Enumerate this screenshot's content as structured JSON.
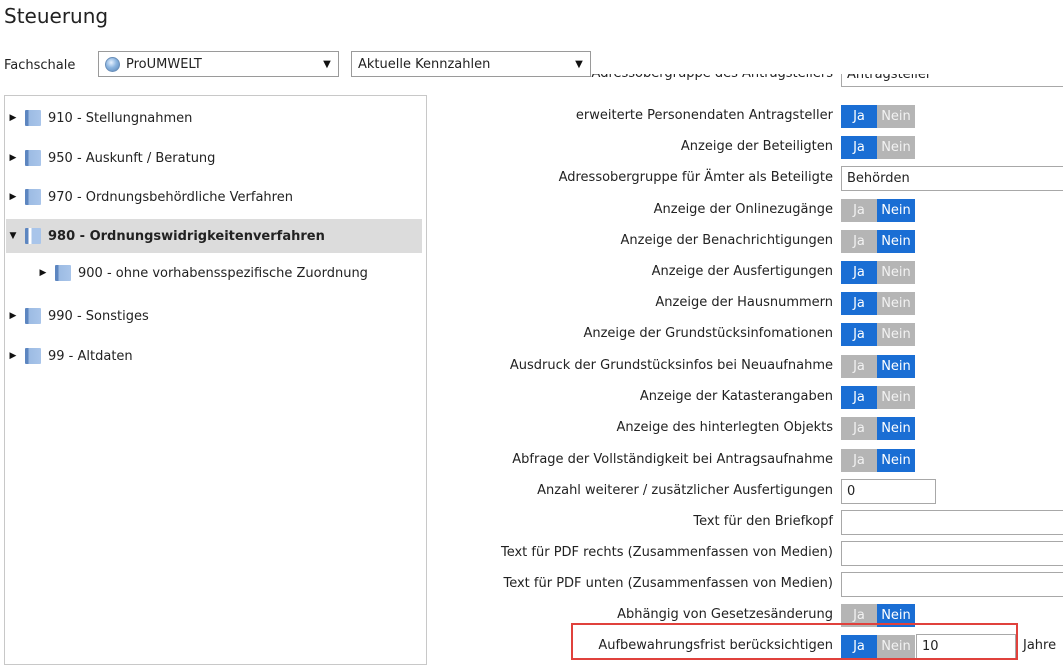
{
  "window": {
    "title": "Steuerung"
  },
  "fachschale": {
    "label": "Fachschale",
    "selected": "ProUMWELT",
    "kennzahlen_selected": "Aktuelle Kennzahlen"
  },
  "tree": {
    "nodes": [
      {
        "label": "910 - Stellungnahmen"
      },
      {
        "label": "950 - Auskunft / Beratung"
      },
      {
        "label": "970 - Ordnungsbehördliche Verfahren"
      },
      {
        "label": "980 - Ordnungswidrigkeitenverfahren"
      },
      {
        "label": "900 - ohne vorhabensspezifische Zuordnung"
      },
      {
        "label": "990 - Sonstiges"
      },
      {
        "label": "99 - Altdaten"
      }
    ]
  },
  "toggle": {
    "ja": "Ja",
    "nein": "Nein"
  },
  "form": {
    "top_partial": {
      "label": "Adressobergruppe des Antragstellers",
      "value": "Antragsteller"
    },
    "rows": [
      {
        "label": "erweiterte Personendaten Antragsteller",
        "type": "toggle",
        "value": "Ja"
      },
      {
        "label": "Anzeige der Beteiligten",
        "type": "toggle",
        "value": "Ja"
      },
      {
        "label": "Adressobergruppe für Ämter als Beteiligte",
        "type": "text",
        "value": "Behörden"
      },
      {
        "label": "Anzeige der Onlinezugänge",
        "type": "toggle",
        "value": "Nein"
      },
      {
        "label": "Anzeige der Benachrichtigungen",
        "type": "toggle",
        "value": "Nein"
      },
      {
        "label": "Anzeige der Ausfertigungen",
        "type": "toggle",
        "value": "Ja"
      },
      {
        "label": "Anzeige der Hausnummern",
        "type": "toggle",
        "value": "Ja"
      },
      {
        "label": "Anzeige der Grundstücksinfomationen",
        "type": "toggle",
        "value": "Ja"
      },
      {
        "label": "Ausdruck der Grundstücksinfos bei Neuaufnahme",
        "type": "toggle",
        "value": "Nein"
      },
      {
        "label": "Anzeige der Katasterangaben",
        "type": "toggle",
        "value": "Ja"
      },
      {
        "label": "Anzeige des hinterlegten Objekts",
        "type": "toggle",
        "value": "Nein"
      },
      {
        "label": "Abfrage der Vollständigkeit bei Antragsaufnahme",
        "type": "toggle",
        "value": "Nein"
      },
      {
        "label": "Anzahl weiterer / zusätzlicher Ausfertigungen",
        "type": "number",
        "value": "0"
      },
      {
        "label": "Text für den Briefkopf",
        "type": "text",
        "value": ""
      },
      {
        "label": "Text für PDF rechts (Zusammenfassen von Medien)",
        "type": "text",
        "value": ""
      },
      {
        "label": "Text für PDF unten (Zusammenfassen von Medien)",
        "type": "text",
        "value": ""
      },
      {
        "label": "Abhängig von Gesetzesänderung",
        "type": "toggle",
        "value": "Nein"
      },
      {
        "label": "Aufbewahrungsfrist berücksichtigen",
        "type": "toggle",
        "value": "Ja",
        "number": "10",
        "unit": "Jahre"
      }
    ]
  },
  "colors": {
    "accent": "#1a6ed4",
    "inactive": "#b5b5b5",
    "highlight": "#e0413c",
    "selection": "#dcdcdc"
  }
}
